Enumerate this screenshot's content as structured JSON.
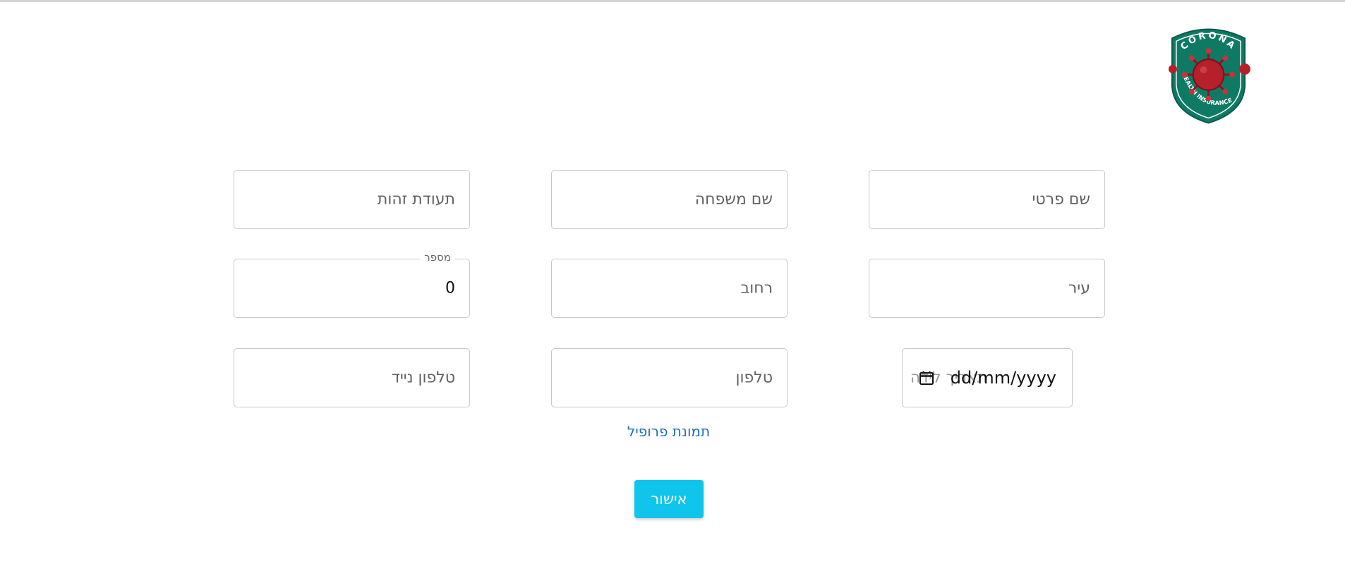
{
  "logo": {
    "top_text": "CORONA",
    "bottom_text": "HEALTH INSURANCE"
  },
  "form": {
    "first_name": {
      "placeholder": "שם פרטי"
    },
    "last_name": {
      "placeholder": "שם משפחה"
    },
    "id_number": {
      "placeholder": "תעודת זהות"
    },
    "city": {
      "placeholder": "עיר"
    },
    "street": {
      "placeholder": "רחוב"
    },
    "house_number": {
      "label": "מספר",
      "value": "0"
    },
    "birth_date": {
      "placeholder": "תאריך לידה",
      "value": "dd/mm/yyyy"
    },
    "phone": {
      "placeholder": "טלפון"
    },
    "mobile": {
      "placeholder": "טלפון נייד"
    }
  },
  "profile_picture_link": "תמונת פרופיל",
  "submit_label": "אישור",
  "colors": {
    "accent": "#10c5ec",
    "link": "#1f6fc0",
    "logo_green": "#0f7a64",
    "virus_red": "#b5202b"
  }
}
